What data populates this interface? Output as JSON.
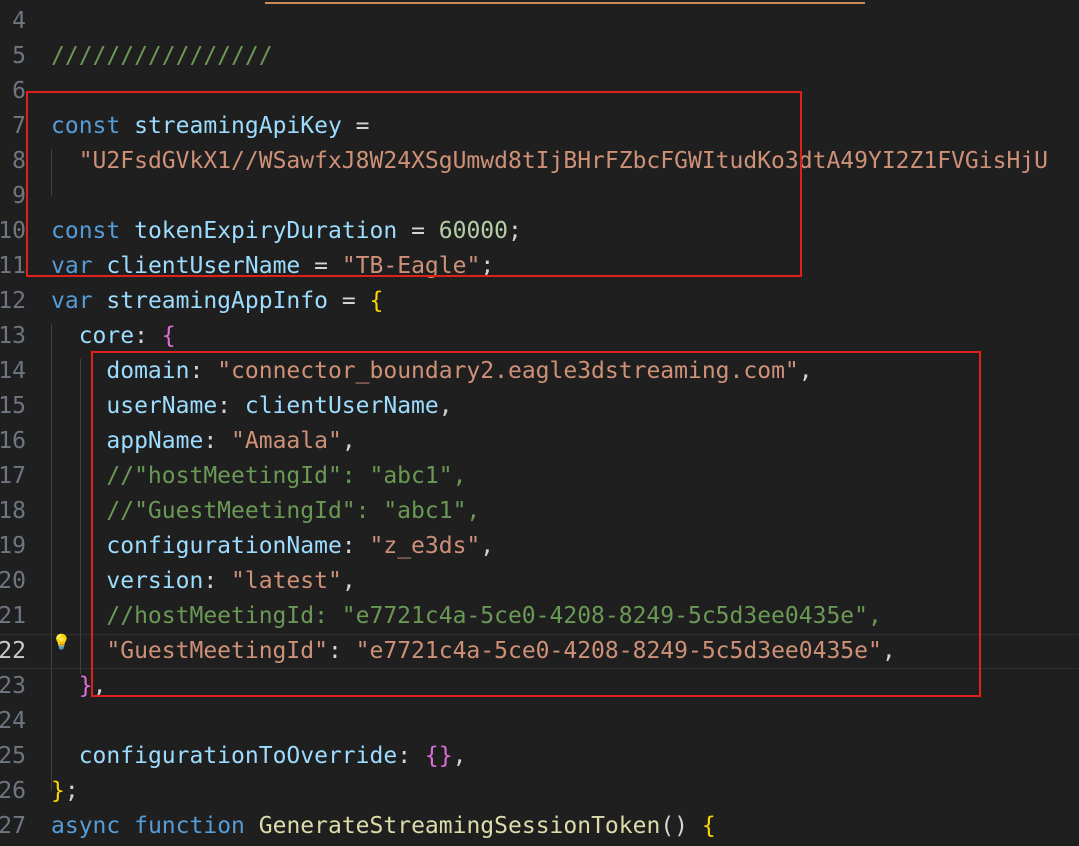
{
  "editor": {
    "lines": [
      {
        "n": "4",
        "tokens": []
      },
      {
        "n": "5",
        "tokens": [
          {
            "t": "////////////////",
            "c": "cm"
          }
        ]
      },
      {
        "n": "6",
        "tokens": []
      },
      {
        "n": "7",
        "tokens": [
          {
            "t": "const",
            "c": "kw"
          },
          {
            "t": " ",
            "c": "op"
          },
          {
            "t": "streamingApiKey",
            "c": "vr"
          },
          {
            "t": " =",
            "c": "op"
          }
        ]
      },
      {
        "n": "8",
        "tokens": [
          {
            "t": "  ",
            "c": "op"
          },
          {
            "t": "\"U2FsdGVkX1//WSawfxJ8W24XSgUmwd8tIjBHrFZbcFGWItudKo3dtA49YI2Z1FVGisHjU",
            "c": "str"
          }
        ]
      },
      {
        "n": "9",
        "tokens": []
      },
      {
        "n": "10",
        "tokens": [
          {
            "t": "const",
            "c": "kw"
          },
          {
            "t": " ",
            "c": "op"
          },
          {
            "t": "tokenExpiryDuration",
            "c": "vr"
          },
          {
            "t": " = ",
            "c": "op"
          },
          {
            "t": "60000",
            "c": "num"
          },
          {
            "t": ";",
            "c": "op"
          }
        ]
      },
      {
        "n": "11",
        "tokens": [
          {
            "t": "var",
            "c": "kw"
          },
          {
            "t": " ",
            "c": "op"
          },
          {
            "t": "clientUserName",
            "c": "vr"
          },
          {
            "t": " = ",
            "c": "op"
          },
          {
            "t": "\"TB-Eagle\"",
            "c": "str"
          },
          {
            "t": ";",
            "c": "op"
          }
        ]
      },
      {
        "n": "12",
        "tokens": [
          {
            "t": "var",
            "c": "kw"
          },
          {
            "t": " ",
            "c": "op"
          },
          {
            "t": "streamingAppInfo",
            "c": "vr"
          },
          {
            "t": " = ",
            "c": "op"
          },
          {
            "t": "{",
            "c": "p1"
          }
        ]
      },
      {
        "n": "13",
        "tokens": [
          {
            "t": "  ",
            "c": "op"
          },
          {
            "t": "core",
            "c": "vr"
          },
          {
            "t": ": ",
            "c": "op"
          },
          {
            "t": "{",
            "c": "p2"
          }
        ]
      },
      {
        "n": "14",
        "tokens": [
          {
            "t": "    ",
            "c": "op"
          },
          {
            "t": "domain",
            "c": "vr"
          },
          {
            "t": ": ",
            "c": "op"
          },
          {
            "t": "\"connector_boundary2.eagle3dstreaming.com\"",
            "c": "str"
          },
          {
            "t": ",",
            "c": "op"
          }
        ]
      },
      {
        "n": "15",
        "tokens": [
          {
            "t": "    ",
            "c": "op"
          },
          {
            "t": "userName",
            "c": "vr"
          },
          {
            "t": ": ",
            "c": "op"
          },
          {
            "t": "clientUserName",
            "c": "vr"
          },
          {
            "t": ",",
            "c": "op"
          }
        ]
      },
      {
        "n": "16",
        "tokens": [
          {
            "t": "    ",
            "c": "op"
          },
          {
            "t": "appName",
            "c": "vr"
          },
          {
            "t": ": ",
            "c": "op"
          },
          {
            "t": "\"Amaala\"",
            "c": "str"
          },
          {
            "t": ",",
            "c": "op"
          }
        ]
      },
      {
        "n": "17",
        "tokens": [
          {
            "t": "    ",
            "c": "op"
          },
          {
            "t": "//\"hostMeetingId\": \"abc1\",",
            "c": "cm"
          }
        ]
      },
      {
        "n": "18",
        "tokens": [
          {
            "t": "    ",
            "c": "op"
          },
          {
            "t": "//\"GuestMeetingId\": \"abc1\",",
            "c": "cm"
          }
        ]
      },
      {
        "n": "19",
        "tokens": [
          {
            "t": "    ",
            "c": "op"
          },
          {
            "t": "configurationName",
            "c": "vr"
          },
          {
            "t": ": ",
            "c": "op"
          },
          {
            "t": "\"z_e3ds\"",
            "c": "str"
          },
          {
            "t": ",",
            "c": "op"
          }
        ]
      },
      {
        "n": "20",
        "tokens": [
          {
            "t": "    ",
            "c": "op"
          },
          {
            "t": "version",
            "c": "vr"
          },
          {
            "t": ": ",
            "c": "op"
          },
          {
            "t": "\"latest\"",
            "c": "str"
          },
          {
            "t": ",",
            "c": "op"
          }
        ]
      },
      {
        "n": "21",
        "tokens": [
          {
            "t": "    ",
            "c": "op"
          },
          {
            "t": "//hostMeetingId: \"e7721c4a-5ce0-4208-8249-5c5d3ee0435e\",",
            "c": "cm"
          }
        ]
      },
      {
        "n": "22",
        "tokens": [
          {
            "t": "    ",
            "c": "op"
          },
          {
            "t": "\"GuestMeetingId\"",
            "c": "str"
          },
          {
            "t": ": ",
            "c": "op"
          },
          {
            "t": "\"e7721c4a-5ce0-4208-8249-5c5d3ee0435e\"",
            "c": "str"
          },
          {
            "t": ",",
            "c": "op"
          }
        ],
        "current": true
      },
      {
        "n": "23",
        "tokens": [
          {
            "t": "  ",
            "c": "op"
          },
          {
            "t": "}",
            "c": "p2"
          },
          {
            "t": ",",
            "c": "op"
          }
        ]
      },
      {
        "n": "24",
        "tokens": []
      },
      {
        "n": "25",
        "tokens": [
          {
            "t": "  ",
            "c": "op"
          },
          {
            "t": "configurationToOverride",
            "c": "vr"
          },
          {
            "t": ": ",
            "c": "op"
          },
          {
            "t": "{}",
            "c": "p2"
          },
          {
            "t": ",",
            "c": "op"
          }
        ]
      },
      {
        "n": "26",
        "tokens": [
          {
            "t": "}",
            "c": "p1"
          },
          {
            "t": ";",
            "c": "op"
          }
        ]
      },
      {
        "n": "27",
        "tokens": [
          {
            "t": "async",
            "c": "kw"
          },
          {
            "t": " ",
            "c": "op"
          },
          {
            "t": "function",
            "c": "kw"
          },
          {
            "t": " ",
            "c": "op"
          },
          {
            "t": "GenerateStreamingSessionToken",
            "c": "fn"
          },
          {
            "t": "() ",
            "c": "op"
          },
          {
            "t": "{",
            "c": "p1"
          }
        ]
      }
    ]
  },
  "colors": {
    "background": "#1f1f1f",
    "keyword": "#569cd6",
    "variable": "#9cdcfe",
    "string": "#ce9178",
    "number": "#b5cea8",
    "comment": "#6a9955",
    "function": "#dcdcaa",
    "bracket_level1": "#ffd700",
    "bracket_level2": "#da70d6",
    "annotation_box": "#e0201b"
  },
  "icons": {
    "gutter": "lightbulb-icon"
  }
}
